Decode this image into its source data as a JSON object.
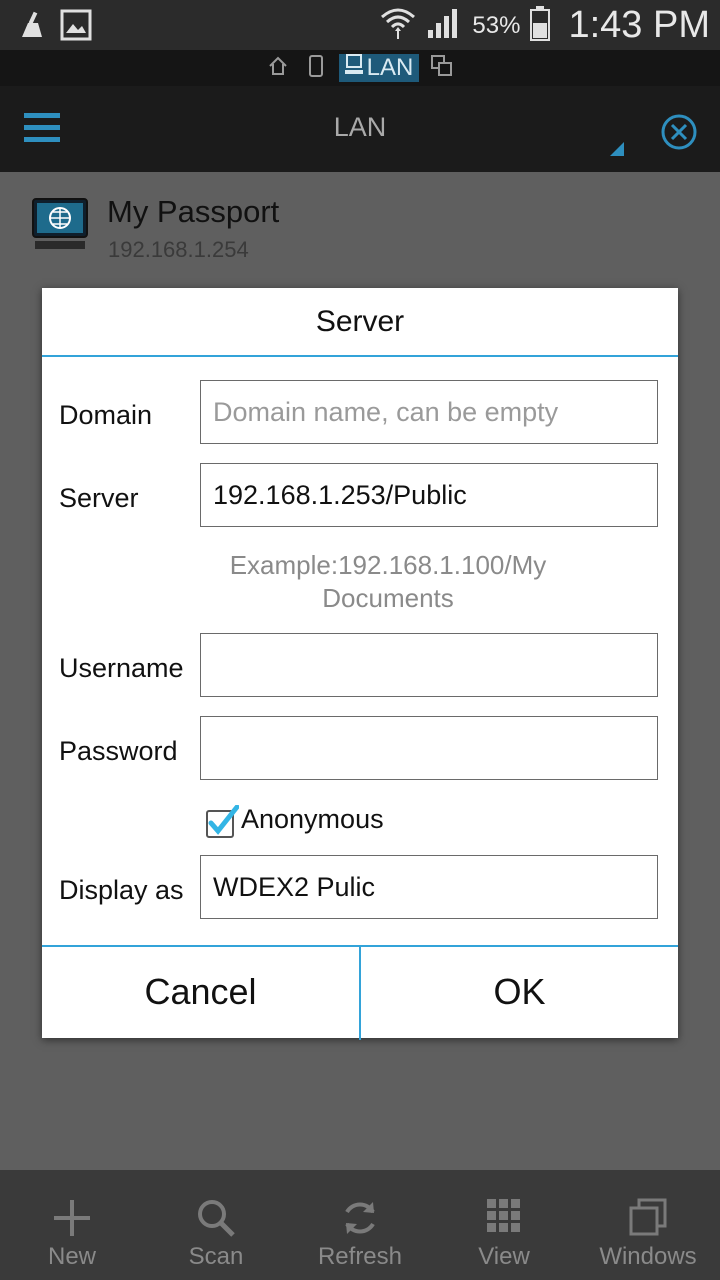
{
  "status": {
    "battery_percent": "53%",
    "time": "1:43 PM"
  },
  "location_bar": {
    "active_label": "LAN"
  },
  "appbar": {
    "title": "LAN"
  },
  "list": {
    "items": [
      {
        "name": "My Passport",
        "ip": "192.168.1.254"
      }
    ]
  },
  "dialog": {
    "title": "Server",
    "domain": {
      "label": "Domain",
      "value": "",
      "placeholder": "Domain name, can be empty"
    },
    "server": {
      "label": "Server",
      "value": "192.168.1.253/Public"
    },
    "example": "Example:192.168.1.100/My Documents",
    "username": {
      "label": "Username",
      "value": ""
    },
    "password": {
      "label": "Password",
      "value": ""
    },
    "anonymous": {
      "label": "Anonymous",
      "checked": true
    },
    "display_as": {
      "label": "Display as",
      "value": "WDEX2 Pulic"
    },
    "cancel_label": "Cancel",
    "ok_label": "OK"
  },
  "bottom_bar": {
    "items": [
      {
        "label": "New",
        "icon": "plus-icon"
      },
      {
        "label": "Scan",
        "icon": "search-icon"
      },
      {
        "label": "Refresh",
        "icon": "refresh-icon"
      },
      {
        "label": "View",
        "icon": "grid-icon"
      },
      {
        "label": "Windows",
        "icon": "windows-icon"
      }
    ]
  },
  "colors": {
    "accent": "#33a3d9",
    "appbar": "#1b1b1b",
    "dim_background": "#5f5f5f"
  }
}
